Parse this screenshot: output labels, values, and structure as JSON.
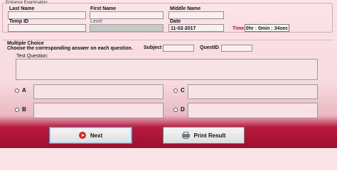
{
  "header": {
    "group_title": "Entrance Examination"
  },
  "fields": {
    "last_name": {
      "label": "Last Name",
      "value": ""
    },
    "first_name": {
      "label": "First Name",
      "value": ""
    },
    "middle_name": {
      "label": "Middle Name",
      "value": ""
    },
    "temp_id": {
      "label": "Temp ID",
      "value": ""
    },
    "level": {
      "label": "Level",
      "value": ""
    },
    "date": {
      "label": "Date",
      "value": "11-02-2017"
    },
    "time": {
      "label": "Time:",
      "value": "0hr : 0min : 34sec"
    }
  },
  "multiple_choice": {
    "title": "Multiple Choice",
    "instruction": "Choose the corresponding answer on each question.",
    "subject_label": "Subject",
    "subject_value": "",
    "questid_label": "QuestID",
    "questid_value": "",
    "question_label": "Test Question:",
    "choices": [
      {
        "letter": "A",
        "text": ""
      },
      {
        "letter": "B",
        "text": ""
      },
      {
        "letter": "C",
        "text": ""
      },
      {
        "letter": "D",
        "text": ""
      }
    ]
  },
  "buttons": {
    "next": "Next",
    "print": "Print Result"
  },
  "icons": {
    "next": "play-circle-icon",
    "print": "printer-icon"
  },
  "colors": {
    "accent_red": "#b71a3d",
    "time_label": "#cc1111"
  }
}
